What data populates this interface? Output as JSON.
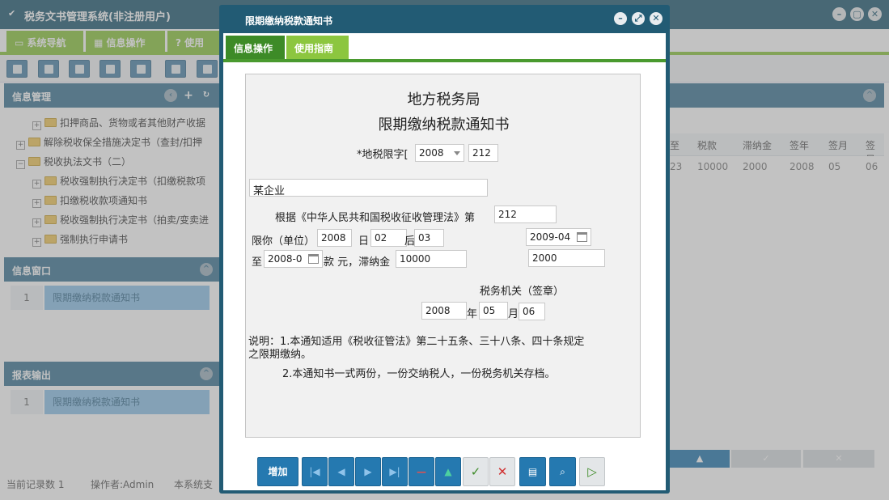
{
  "app": {
    "title": "税务文书管理系统(非注册用户)",
    "tabs": [
      "系统导航",
      "信息操作",
      "使用"
    ],
    "accent": "#8cc63f",
    "header_color": "#225b74"
  },
  "left": {
    "info_mgmt_title": "信息管理",
    "tree": [
      "扣押商品、货物或者其他财产收据",
      "解除税收保全措施决定书（查封/扣押",
      "税收执法文书（二）",
      "税收强制执行决定书（扣缴税款项",
      "扣缴税收款项通知书",
      "税收强制执行决定书（拍卖/变卖进",
      "强制执行申请书"
    ],
    "info_window_title": "信息窗口",
    "info_window_row": {
      "num": "1",
      "text": "限期缴纳税款通知书"
    },
    "report_title": "报表输出",
    "report_row": {
      "num": "1",
      "text": "限期缴纳税款通知书"
    }
  },
  "grid": {
    "headers": [
      "至",
      "税款",
      "滞纳金",
      "签年",
      "签月",
      "签日"
    ],
    "row": [
      "23",
      "10000",
      "2000",
      "2008",
      "05",
      "06"
    ]
  },
  "status": {
    "record_count": "当前记录数 1",
    "operator": "操作者:Admin",
    "system_text": "本系统支"
  },
  "modal": {
    "title": "限期缴纳税款通知书",
    "tabs": [
      "信息操作",
      "使用指南"
    ],
    "heading1": "地方税务局",
    "heading2": "限期缴纳税款通知书",
    "tax_limit_label": "*地税限字[",
    "tax_year": "2008",
    "tax_no": "212",
    "company": "某企业",
    "law_text": "根据《中华人民共和国税收征收管理法》第",
    "law_article": "212",
    "limit_label": "限你（单位）",
    "limit_year": "2008",
    "day_label": "日",
    "limit_day": "02",
    "before_label": "后",
    "limit_month": "03",
    "right_date": "2009-04",
    "to_label": "至",
    "to_date": "2008-0",
    "amount_label": "款 元，滞纳金",
    "amount": "10000",
    "late_fee": "2000",
    "tax_office": "税务机关（签章）",
    "sign_year": "2008",
    "year_label": "年",
    "sign_month": "05",
    "month_label": "月",
    "sign_day": "06",
    "note1": "说明：1.本通知适用《税收征管法》第二十五条、三十八条、四十条规定",
    "note1b": "之限期缴纳。",
    "note2": "2.本通知书一式两份，一份交纳税人，一份税务机关存档。",
    "add_button": "增加"
  }
}
